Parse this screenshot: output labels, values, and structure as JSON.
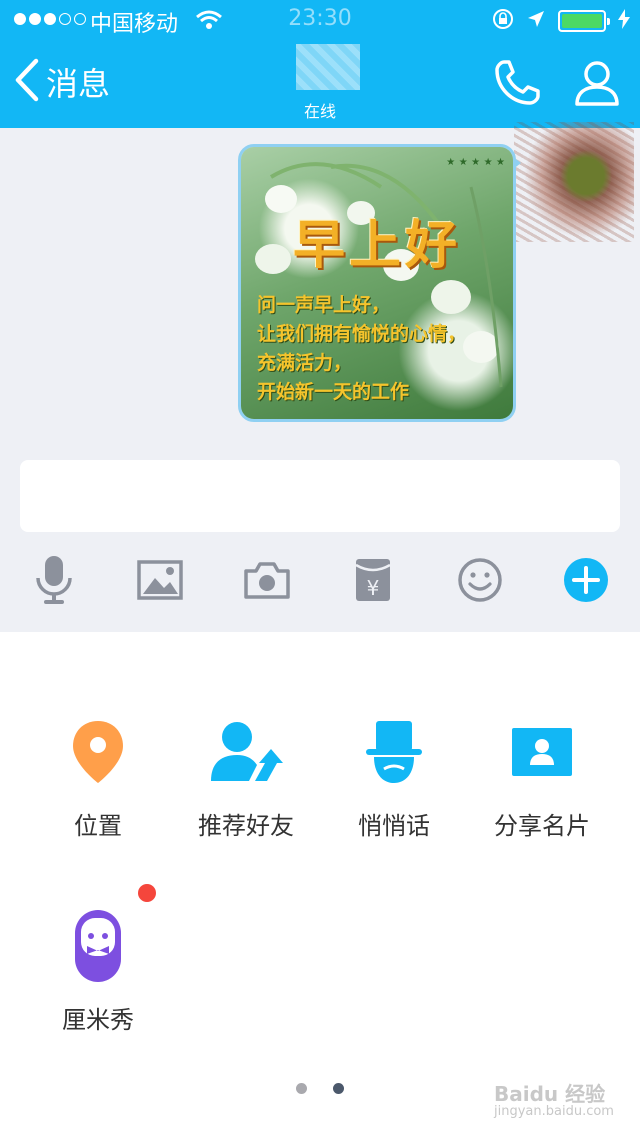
{
  "status_bar": {
    "carrier": "中国移动",
    "time": "23:30",
    "battery_level": 1.0,
    "battery_color": "#4cd964"
  },
  "nav": {
    "back_label": "消息",
    "presence": "在线",
    "icons": [
      "chevron-left-icon",
      "phone-icon",
      "profile-icon"
    ]
  },
  "message": {
    "card_title": "早上好",
    "card_lines": [
      "问一声早上好，",
      "让我们拥有愉悦的心情，",
      "充满活力，",
      "开始新一天的工作"
    ]
  },
  "composer": {
    "value": "",
    "tools": [
      "microphone-icon",
      "image-icon",
      "camera-icon",
      "red-packet-icon",
      "emoji-icon",
      "plus-icon"
    ]
  },
  "panel": {
    "items": [
      {
        "label": "位置",
        "icon": "location-pin-icon",
        "color": "#ff9f4a"
      },
      {
        "label": "推荐好友",
        "icon": "recommend-friend-icon",
        "color": "#12b7f5"
      },
      {
        "label": "悄悄话",
        "icon": "whisper-mask-icon",
        "color": "#12b7f5"
      },
      {
        "label": "分享名片",
        "icon": "contact-card-icon",
        "color": "#12b7f5"
      },
      {
        "label": "厘米秀",
        "icon": "cmshow-icon",
        "color": "#7d4fe0",
        "has_badge": true
      }
    ],
    "pages": 2,
    "current_page": 2
  },
  "watermark": {
    "brand": "Baidu 经验",
    "url": "jingyan.baidu.com"
  },
  "colors": {
    "accent": "#12b7f5",
    "background": "#eef0f5",
    "badge": "#f5463c"
  }
}
